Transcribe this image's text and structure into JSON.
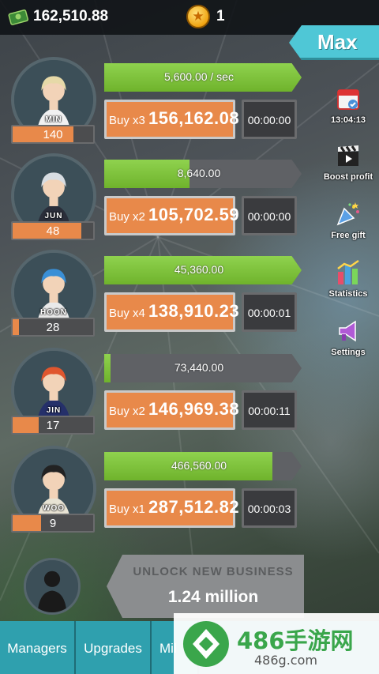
{
  "header": {
    "cash": "162,510.88",
    "coins": "1",
    "max_label": "Max"
  },
  "businesses": [
    {
      "name": "MIN",
      "level": "140",
      "level_progress": 0.75,
      "income_text": "5,600.00 / sec",
      "income_progress": 1.0,
      "buy_label": "Buy x3",
      "buy_price": "156,162.08",
      "timer": "00:00:00"
    },
    {
      "name": "JUN",
      "level": "48",
      "level_progress": 0.85,
      "income_text": "8,640.00",
      "income_progress": 0.43,
      "buy_label": "Buy x2",
      "buy_price": "105,702.59",
      "timer": "00:00:00"
    },
    {
      "name": "HOON",
      "level": "28",
      "level_progress": 0.08,
      "income_text": "45,360.00",
      "income_progress": 1.0,
      "buy_label": "Buy x4",
      "buy_price": "138,910.23",
      "timer": "00:00:01"
    },
    {
      "name": "JIN",
      "level": "17",
      "level_progress": 0.32,
      "income_text": "73,440.00",
      "income_progress": 0.03,
      "buy_label": "Buy x2",
      "buy_price": "146,969.38",
      "timer": "00:00:11"
    },
    {
      "name": "WOO",
      "level": "9",
      "level_progress": 0.35,
      "income_text": "466,560.00",
      "income_progress": 0.85,
      "buy_label": "Buy x1",
      "buy_price": "287,512.82",
      "timer": "00:00:03"
    }
  ],
  "side_menu": [
    {
      "label": "13:04:13",
      "icon": "calendar-icon"
    },
    {
      "label": "Boost profit",
      "icon": "clapperboard-icon"
    },
    {
      "label": "Free gift",
      "icon": "party-popper-icon"
    },
    {
      "label": "Statistics",
      "icon": "bar-chart-icon"
    },
    {
      "label": "Settings",
      "icon": "megaphone-icon"
    }
  ],
  "unlock": {
    "title": "UNLOCK NEW BUSINESS",
    "cost": "1.24 million"
  },
  "tabs": [
    "Managers",
    "Upgrades",
    "Mil"
  ],
  "watermark": {
    "text": "486手游网",
    "sub": "486g.com"
  }
}
